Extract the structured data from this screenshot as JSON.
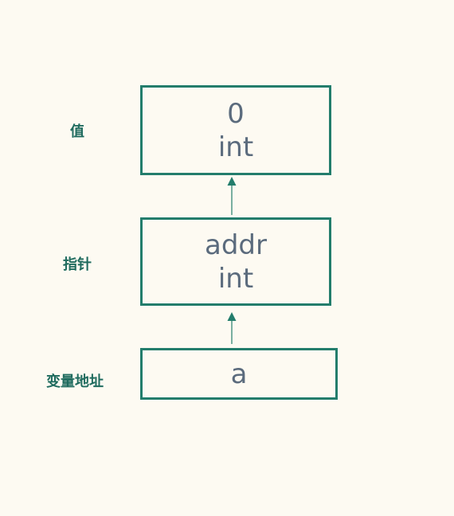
{
  "labels": {
    "value": "值",
    "pointer": "指针",
    "variable_address": "变量地址"
  },
  "boxes": {
    "value": {
      "line1": "0",
      "line2": "int"
    },
    "pointer": {
      "line1": "addr",
      "line2": "int"
    },
    "variable": {
      "line1": "a"
    }
  },
  "colors": {
    "background": "#fdfaf2",
    "border": "#237d6c",
    "label": "#1f6b5e",
    "text": "#5b6b7d"
  }
}
